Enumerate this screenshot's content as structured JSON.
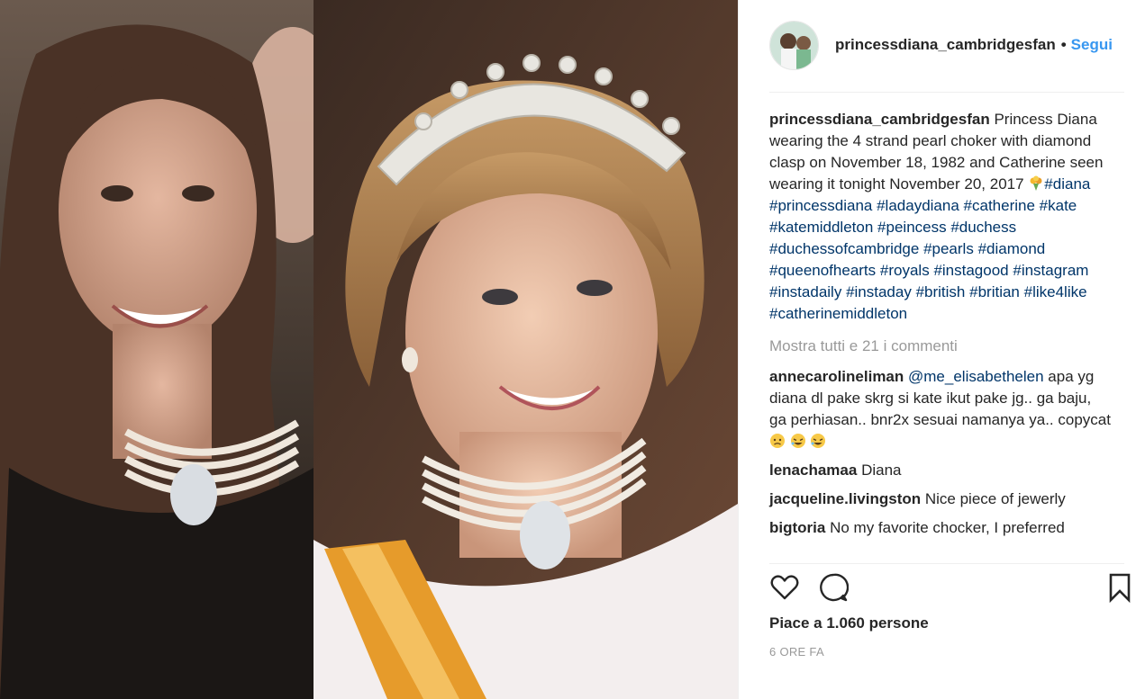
{
  "post": {
    "username": "princessdiana_cambridgesfan",
    "separator": "•",
    "follow_label": "Segui",
    "caption_text_1": "Princess Diana wearing the 4 strand pearl choker with diamond clasp on November 18, 1982 and Catherine seen wearing it tonight November 20, 2017",
    "caption_emoji": "bouquet-emoji",
    "hashtags": [
      "#diana",
      "#princessdiana",
      "#ladaydiana",
      "#catherine",
      "#kate",
      "#katemiddleton",
      "#peincess",
      "#duchess",
      "#duchessofcambridge",
      "#pearls",
      "#diamond",
      "#queenofhearts",
      "#royals",
      "#instagood",
      "#instagram",
      "#instadaily",
      "#instaday",
      "#british",
      "#britian",
      "#like4like",
      "#catherinemiddleton"
    ],
    "view_all_comments": "Mostra tutti e 21 i commenti",
    "likes_label": "Piace a 1.060 persone",
    "timestamp": "6 ORE FA"
  },
  "comments": [
    {
      "user": "annecarolineliman",
      "mention": "@me_elisabethelen",
      "text": "apa yg diana dl pake skrg si kate ikut pake jg.. ga baju, ga perhiasan.. bnr2x sesuai namanya ya.. copycat",
      "emojis": [
        "disappointed-face-emoji",
        "rofl-emoji",
        "rofl-emoji"
      ]
    },
    {
      "user": "lenachamaa",
      "text": "Diana"
    },
    {
      "user": "jacqueline.livingston",
      "text": "Nice piece of jewerly"
    },
    {
      "user": "bigtoria",
      "text": "No my favorite chocker, I preferred"
    }
  ],
  "icons": {
    "like": "heart-icon",
    "comment": "comment-bubble-icon",
    "save": "bookmark-icon"
  },
  "colors": {
    "link": "#3897f0",
    "hashtag": "#003569",
    "muted": "#999999",
    "text": "#262626"
  }
}
